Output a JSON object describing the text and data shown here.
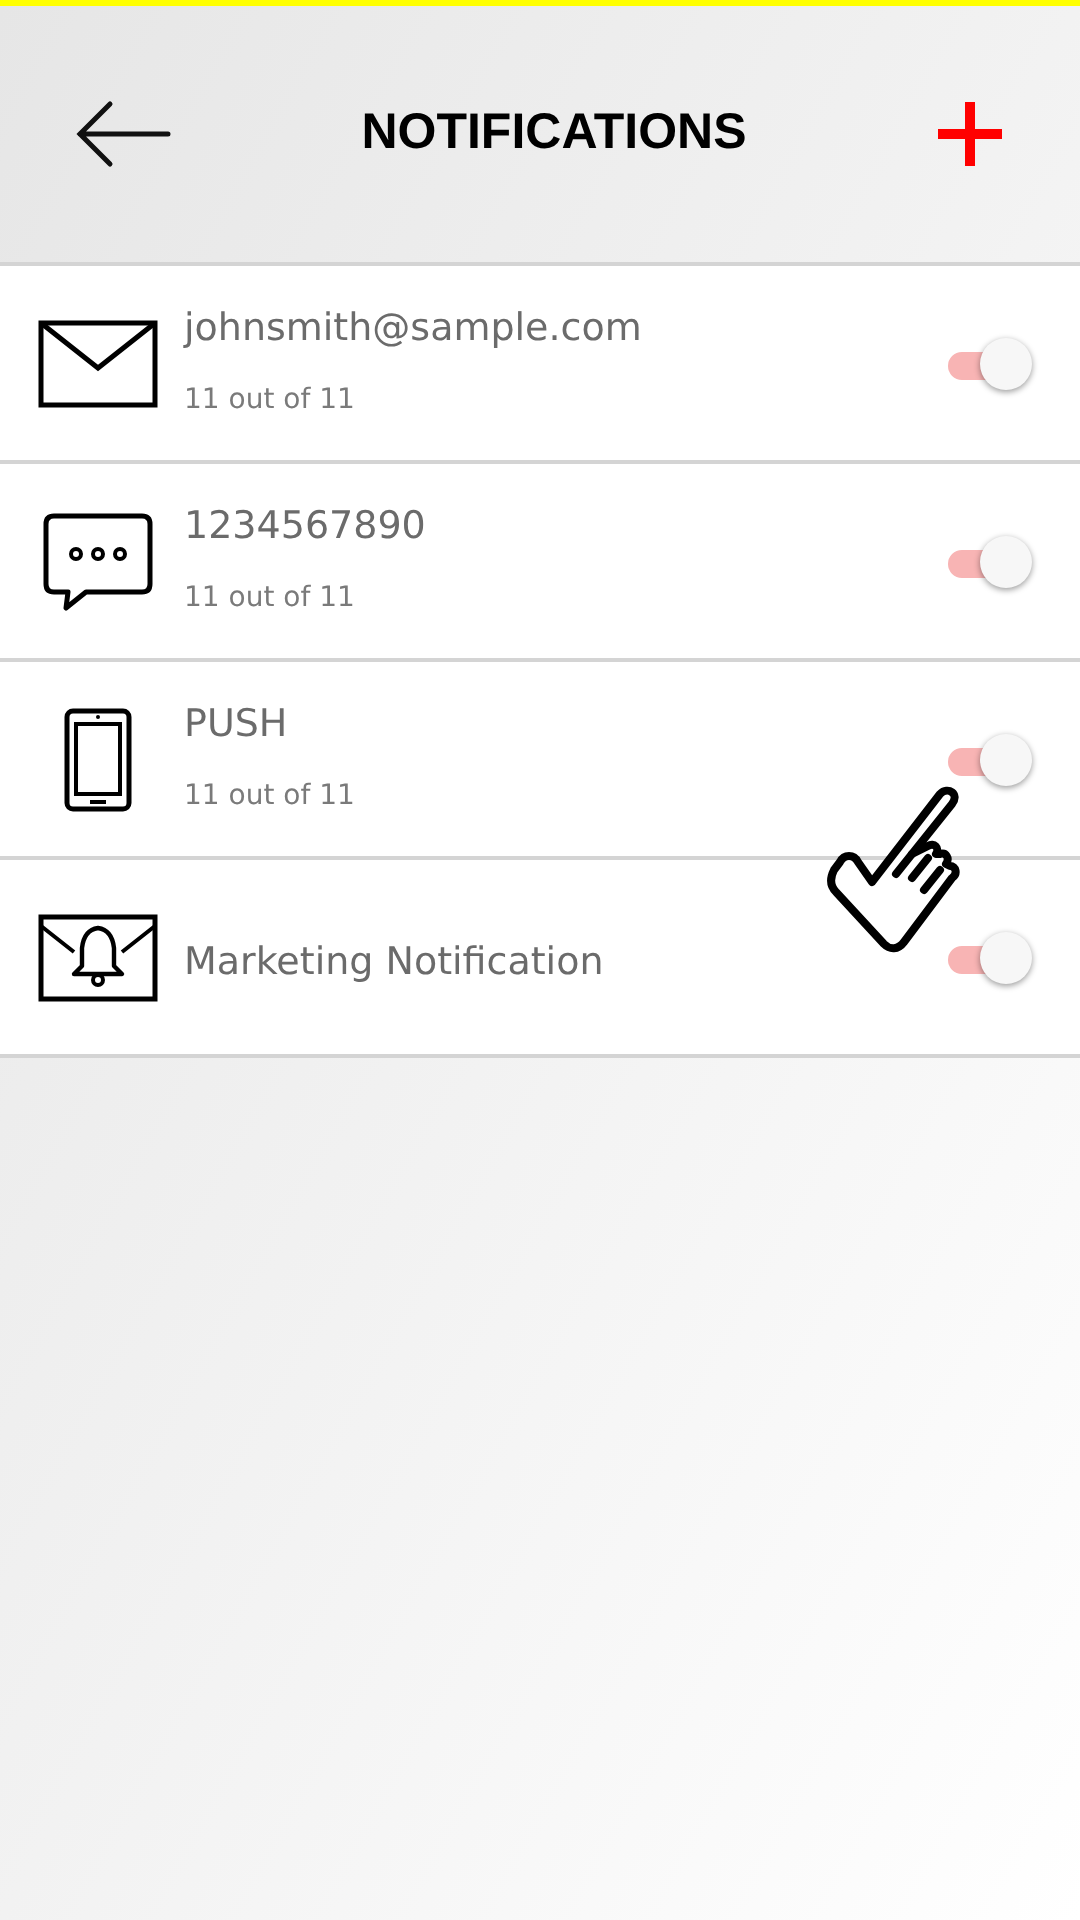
{
  "header": {
    "title": "NOTIFICATIONS"
  },
  "channels": [
    {
      "kind": "email",
      "title": "johnsmith@sample.com",
      "subtitle": "11 out of 11",
      "on": true
    },
    {
      "kind": "sms",
      "title": "1234567890",
      "subtitle": "11 out of 11",
      "on": true
    },
    {
      "kind": "push",
      "title": "PUSH",
      "subtitle": "11 out of 11",
      "on": true
    },
    {
      "kind": "marketing",
      "title": "Marketing Notification",
      "on": true
    }
  ]
}
